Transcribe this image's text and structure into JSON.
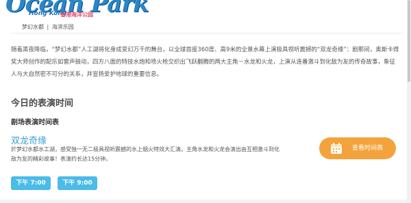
{
  "logo": {
    "brand": "Ocean Park",
    "sub": "Hong Kong",
    "cn": "香港海洋公园"
  },
  "breadcrumb": [
    "梦幻水都",
    "|",
    "海滨乐园"
  ],
  "intro": "随着黑夜降临，“梦幻水都”人工湖将化身成变幻万千的舞台，以全球首座360度、高9米的全景水幕上演极具视听震撼的“双龙奇缘”：剧那间，奥斯卡得奖大师创作的配乐如雷声鼓动，四方八面的特技水炮和喷火枪交织出飞跃翻腾的两大主角－水龙和火龙，上演从连番激斗到化敌为友的传奇故事，象征人与大自然密不可分的关系，并宣扬爱护地球的重要信息。",
  "section_title": "今日的表演时间",
  "subsection_title": "剧场表演时间表",
  "show": {
    "title": "双龙奇缘",
    "description": "於梦幻水都水工湖，感受独一无二极具视听震撼的水上烟火特效大汇演。主角水龙和火龙会演出由互相激斗到化敌为友的精彩故事！表演约长达15分钟。"
  },
  "showtimes": [
    "下午 7:00",
    "下午 9:00"
  ],
  "timetable_button": {
    "label": "查看时间表",
    "icon": "calendar-icon",
    "color": "#f4a33c"
  },
  "colors": {
    "accent_blue": "#3aa0d8",
    "time_button": "#4bbbe8"
  }
}
